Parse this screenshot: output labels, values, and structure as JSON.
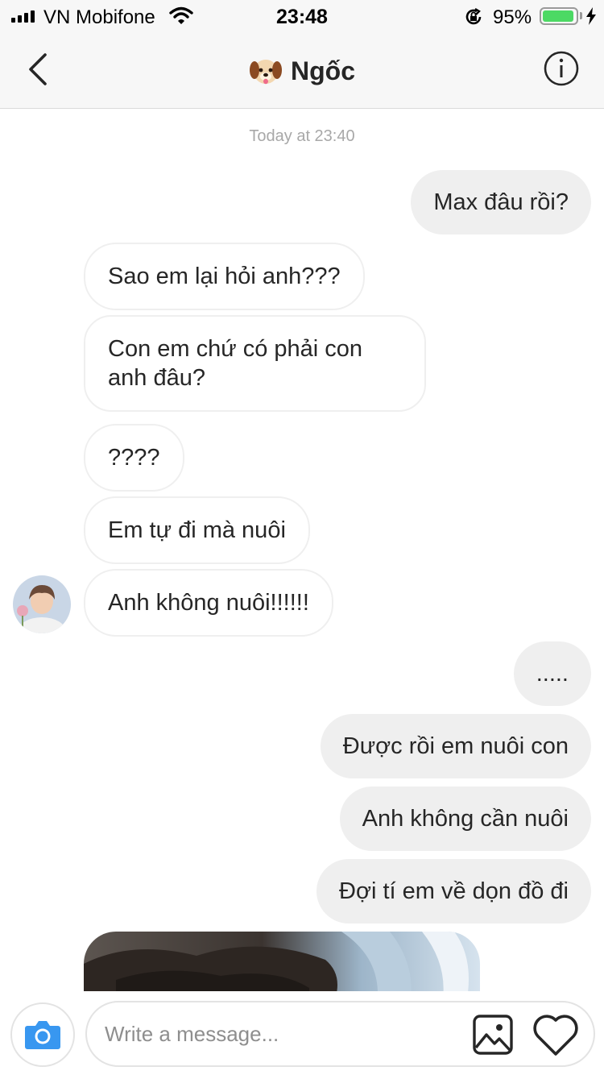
{
  "status_bar": {
    "carrier": "VN Mobifone",
    "time": "23:48",
    "battery_percent": "95%",
    "battery_level": 0.95,
    "icons": [
      "signal-icon",
      "wifi-icon",
      "rotation-lock-icon",
      "battery-icon",
      "charging-icon"
    ]
  },
  "header": {
    "title": "Ngốc",
    "title_emoji": "dog-face-emoji",
    "back_icon": "chevron-left-icon",
    "info_icon": "info-icon"
  },
  "thread": {
    "timestamp": "Today at 23:40",
    "messages": [
      {
        "direction": "outgoing",
        "text": "Max đâu rồi?"
      },
      {
        "direction": "incoming",
        "text": "Sao em lại hỏi anh???"
      },
      {
        "direction": "incoming",
        "text": "Con em chứ có phải con anh đâu?"
      },
      {
        "direction": "incoming",
        "text": "????"
      },
      {
        "direction": "incoming",
        "text": "Em tự đi mà nuôi"
      },
      {
        "direction": "incoming",
        "text": "Anh không nuôi!!!!!!"
      },
      {
        "direction": "outgoing",
        "text": "....."
      },
      {
        "direction": "outgoing",
        "text": "Được rồi em nuôi con"
      },
      {
        "direction": "outgoing",
        "text": "Anh không cần nuôi"
      },
      {
        "direction": "outgoing",
        "text": "Đợi tí em về dọn đồ đi"
      },
      {
        "direction": "incoming",
        "type": "photo"
      }
    ]
  },
  "composer": {
    "placeholder": "Write a message...",
    "value": "",
    "icons": [
      "camera-icon",
      "gallery-icon",
      "heart-icon"
    ]
  },
  "colors": {
    "bar_background": "#f7f7f7",
    "outgoing_bubble": "#efefef",
    "incoming_border": "#efefef",
    "camera_blue": "#3897f0",
    "battery_green": "#4cd964",
    "muted_text": "#a8a8a8"
  }
}
